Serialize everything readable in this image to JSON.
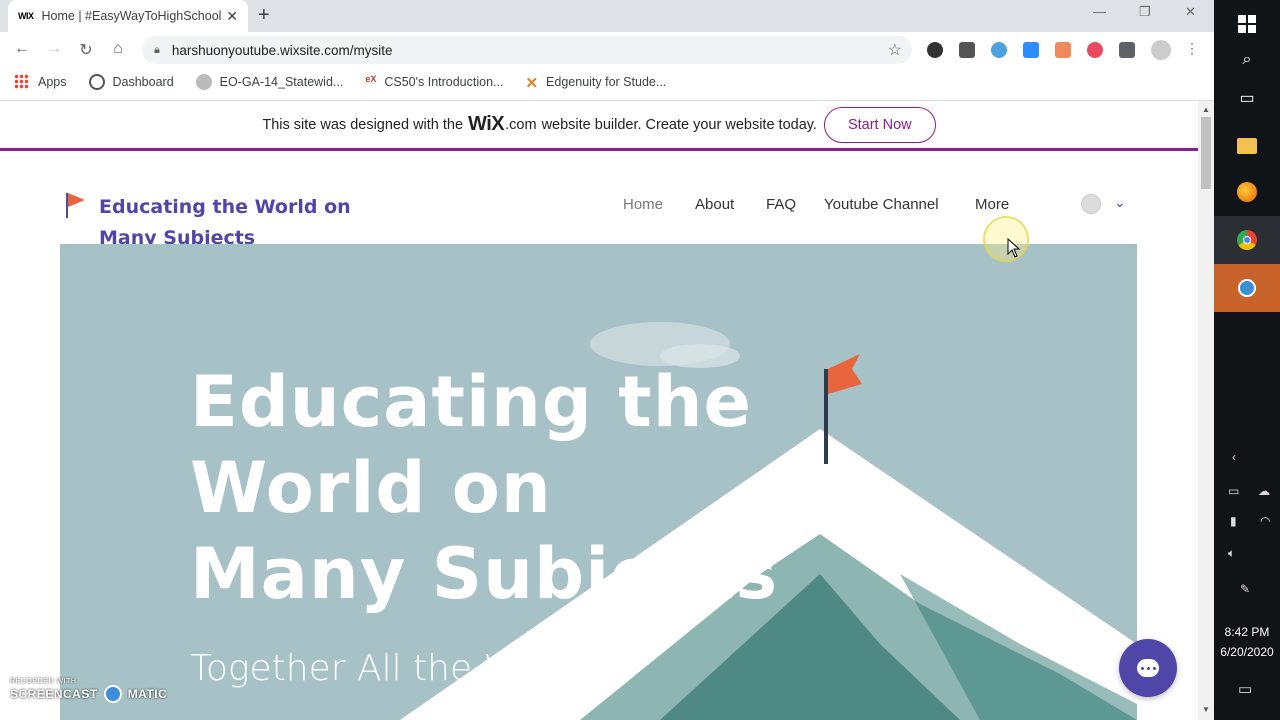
{
  "browser": {
    "tab_title": "Home | #EasyWayToHighSchool",
    "tab_favicon": "WIX",
    "url": "harshuonyoutube.wixsite.com/mysite",
    "bookmarks": [
      {
        "label": "Apps",
        "icon": "apps-grid-icon",
        "color": "#1a73e8"
      },
      {
        "label": "Dashboard",
        "icon": "dashboard-icon",
        "color": "#555555"
      },
      {
        "label": "EO-GA-14_Statewid...",
        "icon": "seal-icon",
        "color": "#999999"
      },
      {
        "label": "CS50's Introduction...",
        "icon": "edx-icon",
        "color": "#c0392b"
      },
      {
        "label": "Edgenuity for Stude...",
        "icon": "edgenuity-icon",
        "color": "#e67e22"
      }
    ]
  },
  "wix_banner": {
    "text_before": "This site was designed with the",
    "logo": "WiX",
    "logo_suffix": ".com",
    "text_after": "website builder. Create your website today.",
    "cta": "Start Now",
    "accent": "#8a1d8f"
  },
  "site": {
    "title": "Educating the World on Many Subjects",
    "nav": [
      "Home",
      "About",
      "FAQ",
      "Youtube Channel",
      "More"
    ],
    "active_nav": "Home",
    "brand_color": "#5046a8"
  },
  "hero": {
    "title_line1": "Educating the",
    "title_line2": "World on",
    "title_line3": "Many Subjects",
    "subtitle": "Together All the Way",
    "bg_color": "#a7c2c6"
  },
  "watermark": {
    "line1": "RECORDED WITH",
    "line2_a": "SCREENCAST",
    "line2_b": "MATIC"
  },
  "taskbar": {
    "time": "8:42 PM",
    "date": "6/20/2020"
  }
}
